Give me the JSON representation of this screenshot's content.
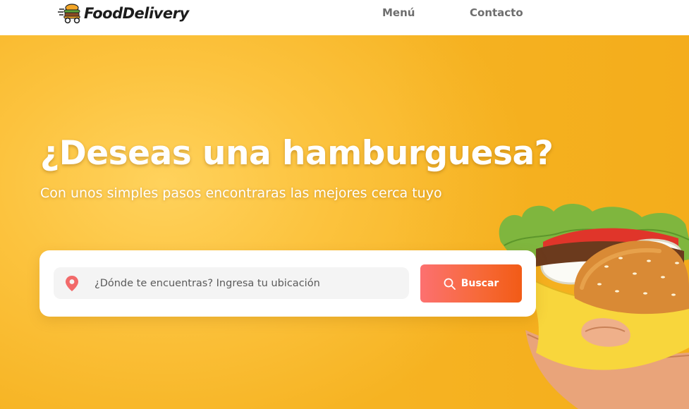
{
  "header": {
    "brand": "FoodDelivery",
    "nav": [
      {
        "label": "Menú"
      },
      {
        "label": "Contacto"
      }
    ]
  },
  "hero": {
    "title": "¿Deseas una hamburguesa?",
    "subtitle": "Con unos simples pasos encontraras las mejores cerca tuyo",
    "illustration": "burger-in-hand-icon"
  },
  "search": {
    "location_icon": "location-pin-icon",
    "placeholder": "¿Dónde te encuentras? Ingresa tu ubicación",
    "value": "",
    "button_label": "Buscar",
    "button_icon": "search-icon"
  },
  "colors": {
    "background_yellow": "#fcc33e",
    "button_gradient_start": "#fc7070",
    "button_gradient_end": "#f25b16",
    "pin_red": "#f26a6a",
    "nav_text": "#6e6e6e"
  }
}
